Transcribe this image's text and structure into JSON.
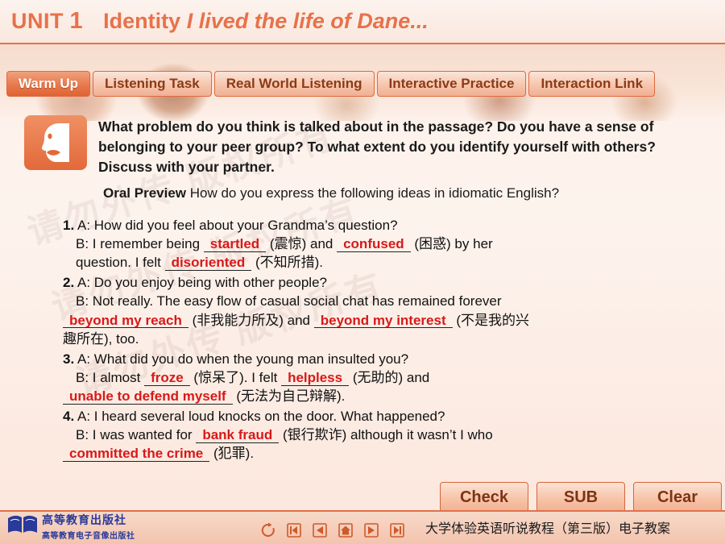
{
  "header": {
    "unit_label": "UNIT",
    "unit_number": "1",
    "topic": "Identity",
    "subtitle": "I lived the life of Dane..."
  },
  "tabs": [
    {
      "label": "Warm Up",
      "active": true
    },
    {
      "label": "Listening Task",
      "active": false
    },
    {
      "label": "Real World Listening",
      "active": false
    },
    {
      "label": "Interactive Practice",
      "active": false
    },
    {
      "label": "Interaction Link",
      "active": false
    }
  ],
  "prompt": "What problem do you think is talked about in the passage? Do you have a sense of belonging to your peer group? To what extent do you identify yourself with others? Discuss with your partner.",
  "oral_preview": {
    "lead": "Oral Preview",
    "text": "How do you express the following ideas in idiomatic English?"
  },
  "items": [
    {
      "num": "1.",
      "a_speaker": "A:",
      "a_text": "How did you feel about your Grandma’s question?",
      "b_speaker": "B:",
      "b_part1": "I remember being",
      "answer1": "startled",
      "gloss1": "(震惊)",
      "b_part2": "and",
      "answer2": "confused",
      "gloss2": "(困惑) by her",
      "b_part3": "question. I felt",
      "answer3": "disoriented",
      "gloss3": "(不知所措)."
    },
    {
      "num": "2.",
      "a_speaker": "A:",
      "a_text": "Do you enjoy being with other people?",
      "b_speaker": "B:",
      "b_part1": "Not really. The easy flow of casual social chat has remained forever",
      "answer1": "beyond my reach",
      "gloss1": "(非我能力所及)",
      "b_part2": "and",
      "answer2": "beyond my interest",
      "gloss2": "(不是我的兴",
      "b_part3": "趣所在), too."
    },
    {
      "num": "3.",
      "a_speaker": "A:",
      "a_text": "What did you do when the young man insulted you?",
      "b_speaker": "B:",
      "b_part1": "I almost",
      "answer1": "froze",
      "gloss1": "(惊呆了). I felt",
      "answer2": "helpless",
      "gloss2": "(无助的) and",
      "answer3": "unable to defend myself",
      "gloss3": "(无法为自己辩解)."
    },
    {
      "num": "4.",
      "a_speaker": "A:",
      "a_text": "I heard several loud knocks on the door. What happened?",
      "b_speaker": "B:",
      "b_part1": "I was wanted for",
      "answer1": "bank fraud",
      "gloss1": "(银行欺诈) although it wasn’t I who",
      "answer2": "committed the crime",
      "gloss2": "(犯罪)."
    }
  ],
  "buttons": [
    {
      "label": "Check"
    },
    {
      "label": "SUB"
    },
    {
      "label": "Clear"
    }
  ],
  "footer": {
    "publisher_big": "高等教育出版社",
    "publisher_small": "高等教育电子音像出版社",
    "title": "大学体验英语听说教程（第三版）电子教案",
    "nav_icons": [
      "refresh-icon",
      "first-icon",
      "previous-icon",
      "home-icon",
      "next-icon",
      "last-icon"
    ]
  },
  "watermark": "请勿外传 版权所有",
  "colors": {
    "accent": "#e8714a",
    "answer": "#d81919",
    "tab_active_text": "#ffffff"
  }
}
